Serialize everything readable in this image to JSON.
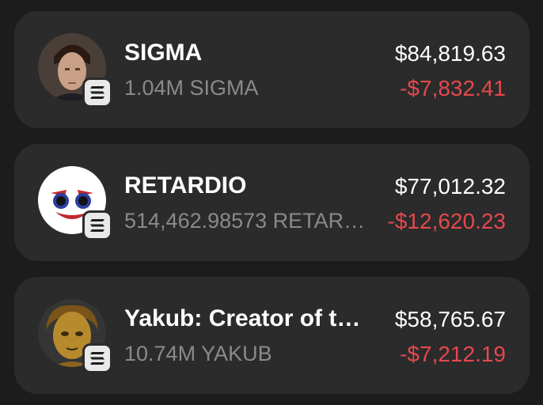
{
  "colors": {
    "background": "#1c1c1c",
    "card": "#2b2b2b",
    "primary_text": "#ffffff",
    "secondary_text": "#8a8a8a",
    "negative": "#e5484d"
  },
  "tokens": [
    {
      "name": "SIGMA",
      "amount": "1.04M SIGMA",
      "value": "$84,819.63",
      "change": "-$7,832.41",
      "avatar_icon": "man-portrait-avatar",
      "chain_icon": "solana-icon"
    },
    {
      "name": "RETARDIO",
      "amount": "514,462.98573 RETAR…",
      "value": "$77,012.32",
      "change": "-$12,620.23",
      "avatar_icon": "clown-face-avatar",
      "chain_icon": "solana-icon"
    },
    {
      "name": "Yakub: Creator of t…",
      "amount": "10.74M YAKUB",
      "value": "$58,765.67",
      "change": "-$7,212.19",
      "avatar_icon": "golden-figure-avatar",
      "chain_icon": "solana-icon"
    }
  ]
}
